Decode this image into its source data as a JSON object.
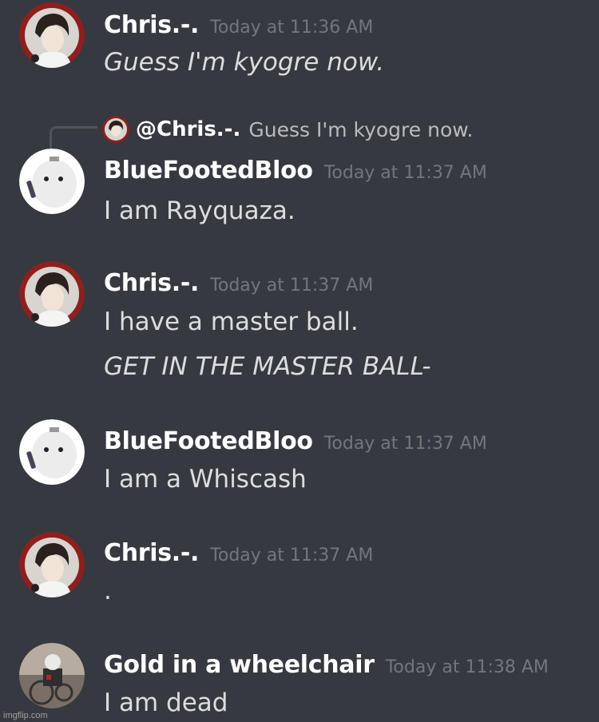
{
  "messages": [
    {
      "author": "Chris.-.",
      "timestamp": "Today at 11:36 AM",
      "lines": [
        "Guess I'm kyogre now."
      ]
    },
    {
      "author": "BlueFootedBloo",
      "timestamp": "Today at 11:37 AM",
      "reply": {
        "author": "@Chris.-.",
        "text": "Guess I'm kyogre now."
      },
      "lines": [
        "I am Rayquaza."
      ]
    },
    {
      "author": "Chris.-.",
      "timestamp": "Today at 11:37 AM",
      "lines": [
        "I have a master ball.",
        "GET IN THE MASTER BALL-"
      ]
    },
    {
      "author": "BlueFootedBloo",
      "timestamp": "Today at 11:37 AM",
      "lines": [
        "I am a Whiscash"
      ]
    },
    {
      "author": "Chris.-.",
      "timestamp": "Today at 11:37 AM",
      "lines": [
        "."
      ]
    },
    {
      "author": "Gold in a wheelchair",
      "timestamp": "Today at 11:38 AM",
      "lines": [
        "I am dead"
      ]
    }
  ],
  "watermark": "imgflip.com",
  "colors": {
    "background": "#36393f",
    "username": "#ffffff",
    "timestamp": "#72767d",
    "message_text": "#dcddde",
    "reply_text": "#b9bbbe"
  }
}
